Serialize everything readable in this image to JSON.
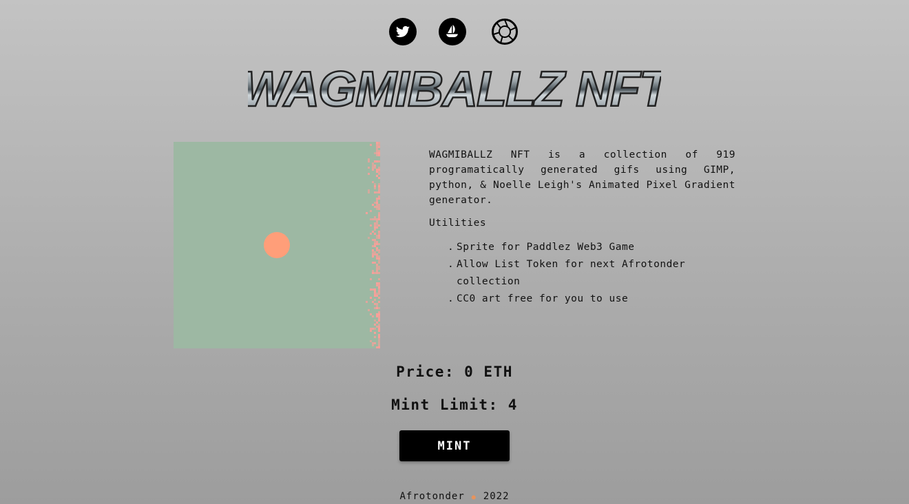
{
  "social": {
    "twitter_icon": "twitter-bird-icon",
    "opensea_icon": "opensea-boat-icon",
    "looksrare_icon": "camera-aperture-icon"
  },
  "logo": {
    "text": "WAGMIBALLZ NFT"
  },
  "artwork": {
    "background_color": "#9db8a3",
    "ball_color": "#ff9e79",
    "noise_color": "#ff9e99"
  },
  "description": {
    "intro": "WAGMIBALLZ NFT is a collection of 919 programatically generated gifs using GIMP, python, & Noelle Leigh's Animated Pixel Gradient generator.",
    "utilities_heading": "Utilities",
    "utilities": [
      "Sprite for Paddlez Web3 Game",
      "Allow List Token for next Afrotonder collection",
      "CC0 art free for you to use"
    ]
  },
  "mint": {
    "price_label": "Price: 0 ETH",
    "limit_label": "Mint Limit: 4",
    "button_label": "MINT"
  },
  "footer": {
    "author": "Afrotonder",
    "separator": "●",
    "year": "2022"
  }
}
